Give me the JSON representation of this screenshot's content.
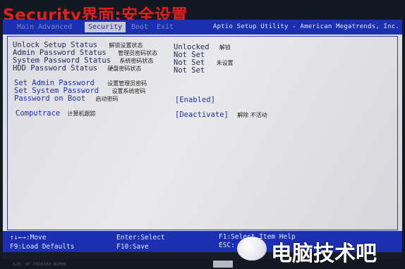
{
  "banner": {
    "title": "Security界面:安全设置"
  },
  "menubar": {
    "tabs": [
      {
        "label": "Main  Advanced"
      },
      {
        "label": "Security"
      },
      {
        "label": "Boot"
      },
      {
        "label": "Exit"
      }
    ],
    "utility_title": "Aptio Setup Utility - American Megatrends, Inc."
  },
  "status_items": [
    {
      "label": "Unlock Setup Status",
      "note": "解锁设置状态",
      "value": "Unlocked",
      "value_note": "解锁"
    },
    {
      "label": "Admin Password Status",
      "note": "管理员密码状态",
      "value": "Not Set",
      "value_note": ""
    },
    {
      "label": "System Password Status",
      "note": "系统密码状态",
      "value": "Not Set",
      "value_note": "未设置"
    },
    {
      "label": "HDD Password Status",
      "note": "硬盘密码状态",
      "value": "Not Set",
      "value_note": ""
    }
  ],
  "actions": [
    {
      "label": "Set Admin Password",
      "note": "设置管理员密码"
    },
    {
      "label": "Set System Password",
      "note": "设置系统密码"
    },
    {
      "label": "Password on Boot",
      "note": "启动密码",
      "value": "[Enabled]"
    }
  ],
  "computrace": {
    "label": "Computrace",
    "note": "计算机跟踪",
    "value": "[Deactivate]",
    "value_note": "解除 不活动"
  },
  "help": {
    "move": "↑↓←→:Move",
    "select": "Enter:Select",
    "help": "F1:Select Item Help",
    "defaults": "F9:Load Defaults",
    "save": "F10:Save",
    "esc": "ESC:"
  },
  "footer": {
    "model": "S/N: 4F FM26500 BGM06"
  },
  "watermark": {
    "text": "电脑技术吧"
  },
  "colors": {
    "bios_blue": "#1b2fb0",
    "bios_bg": "#e2e2e6",
    "banner_red": "#e0201f"
  }
}
